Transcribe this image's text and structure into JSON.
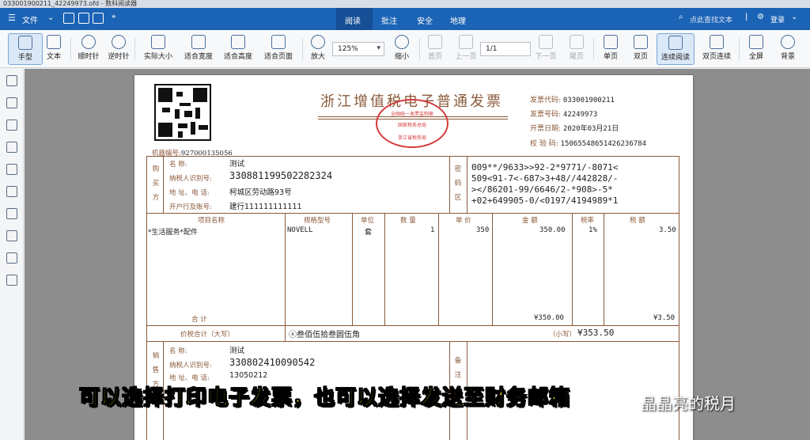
{
  "window": {
    "title": "033001900211_42249973.ofd - 数科阅读器"
  },
  "menubar": {
    "file": "文件",
    "tabs": [
      "阅读",
      "批注",
      "安全",
      "地理"
    ],
    "search": "点此查找文本",
    "login": "登录"
  },
  "toolbar": {
    "hand": "手型",
    "text": "文本",
    "rotate_cw": "顺时针",
    "rotate_ccw": "逆时针",
    "actual_size": "实际大小",
    "fit_width": "适合宽度",
    "fit_height": "适合高度",
    "fit_page": "适合页面",
    "zoom_in": "放大",
    "zoom_value": "125%",
    "zoom_out": "缩小",
    "first_page": "首页",
    "prev_page": "上一页",
    "page_value": "1/1",
    "next_page": "下一页",
    "last_page": "尾页",
    "single": "单页",
    "double": "双页",
    "continuous": "连续阅读",
    "double_continuous": "双页连续",
    "fullscreen": "全屏",
    "background": "背景"
  },
  "invoice": {
    "title": "浙江增值税电子普通发票",
    "stamp_lines": [
      "全国统一发票监制章",
      "国家税务总局",
      "浙江省税务局"
    ],
    "code_label": "发票代码:",
    "code": "033001900211",
    "number_label": "发票号码:",
    "number": "42249973",
    "date_label": "开票日期:",
    "date": "2020年03月21日",
    "check_label": "校 验 码:",
    "check": "15065548651426236784",
    "machine_label": "机器编号:",
    "machine": "927000135056",
    "buyer": {
      "side_label": [
        "购",
        "买",
        "方"
      ],
      "name_label": "名      称:",
      "name": "测试",
      "tax_label": "纳税人识别号:",
      "tax": "330881199502282324",
      "addr_label": "地 址、电 话:",
      "addr": "柯城区劳动路93号",
      "bank_label": "开户行及账号:",
      "bank": "建行111111111111"
    },
    "cipher_label": [
      "密",
      "码",
      "区"
    ],
    "cipher": "009**/9633>>92-2*9771/-8071<\n509<91-7<-687>3+48//442828/-\n></86201-99/6646/2-*908>-5*\n+02+649905-0/<0197/4194989*1",
    "headers": [
      "项目名称",
      "规格型号",
      "单位",
      "数 量",
      "单 价",
      "金 额",
      "税率",
      "税 额"
    ],
    "item": {
      "name": "*生活服务*配件",
      "spec": "NOVELL",
      "unit": "套",
      "qty": "1",
      "price": "350",
      "amount": "350.00",
      "rate": "1%",
      "tax": "3.50"
    },
    "total_label": "合       计",
    "total_amount": "¥350.00",
    "total_tax": "¥3.50",
    "grand_label": "价税合计（大写）",
    "grand_words": "ⓧ叁佰伍拾叁圆伍角",
    "grand_small_label": "（小写）",
    "grand_small": "¥353.50",
    "seller": {
      "side_label": [
        "销",
        "售",
        "方"
      ],
      "name_label": "名      称:",
      "name": "测试",
      "tax_label": "纳税人识别号:",
      "tax": "330802410090542",
      "addr_label": "地 址、电 话:",
      "addr": "13050212"
    },
    "remark_label": [
      "备",
      "注"
    ]
  },
  "overlay": {
    "subtitle": "可以选择打印电子发票，也可以选择发送至财务邮箱",
    "watermark": "晶晶亮的税月"
  }
}
